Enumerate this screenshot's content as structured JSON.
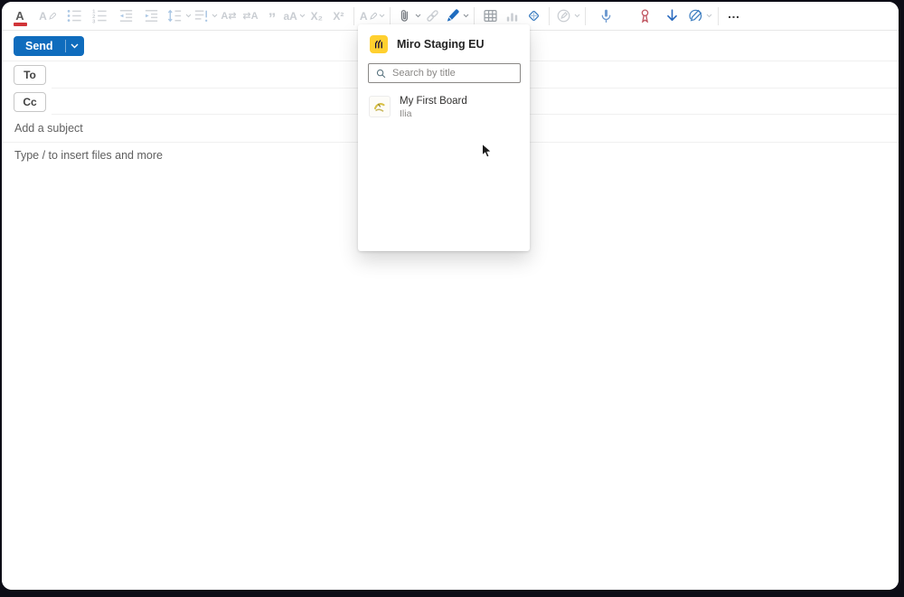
{
  "colors": {
    "accent_blue": "#0f6cbd",
    "miro_yellow": "#ffd02f",
    "font_color_red": "#d13438",
    "frame_dark": "#0d0d16"
  },
  "toolbar": {
    "buttons": [
      "font-color",
      "highlight",
      "bullet-list",
      "numbered-list",
      "decrease-indent",
      "increase-indent",
      "line-spacing",
      "paragraph-spacing",
      "left-to-right",
      "right-to-left",
      "quote",
      "change-case",
      "subscript",
      "superscript",
      "styles",
      "attach-file",
      "insert-link",
      "draw",
      "insert-table",
      "insert-chart",
      "apps",
      "editor",
      "dictate",
      "sensitivity",
      "low-importance",
      "addin",
      "more-options"
    ],
    "glyphs": {
      "font_color": "A",
      "highlight": "A",
      "ltr": "A⇄",
      "rtl": "⇄A",
      "quote": "”",
      "change_case": "aA",
      "subscript": "X₂",
      "superscript": "X²",
      "styles": "A",
      "more": "…"
    }
  },
  "compose": {
    "send_label": "Send",
    "to_label": "To",
    "cc_label": "Cc",
    "subject_placeholder": "Add a subject",
    "body_placeholder": "Type / to insert files and more"
  },
  "popup": {
    "title": "Miro Staging EU",
    "search_placeholder": "Search by title",
    "board": {
      "title": "My First Board",
      "owner": "Ilia"
    }
  }
}
